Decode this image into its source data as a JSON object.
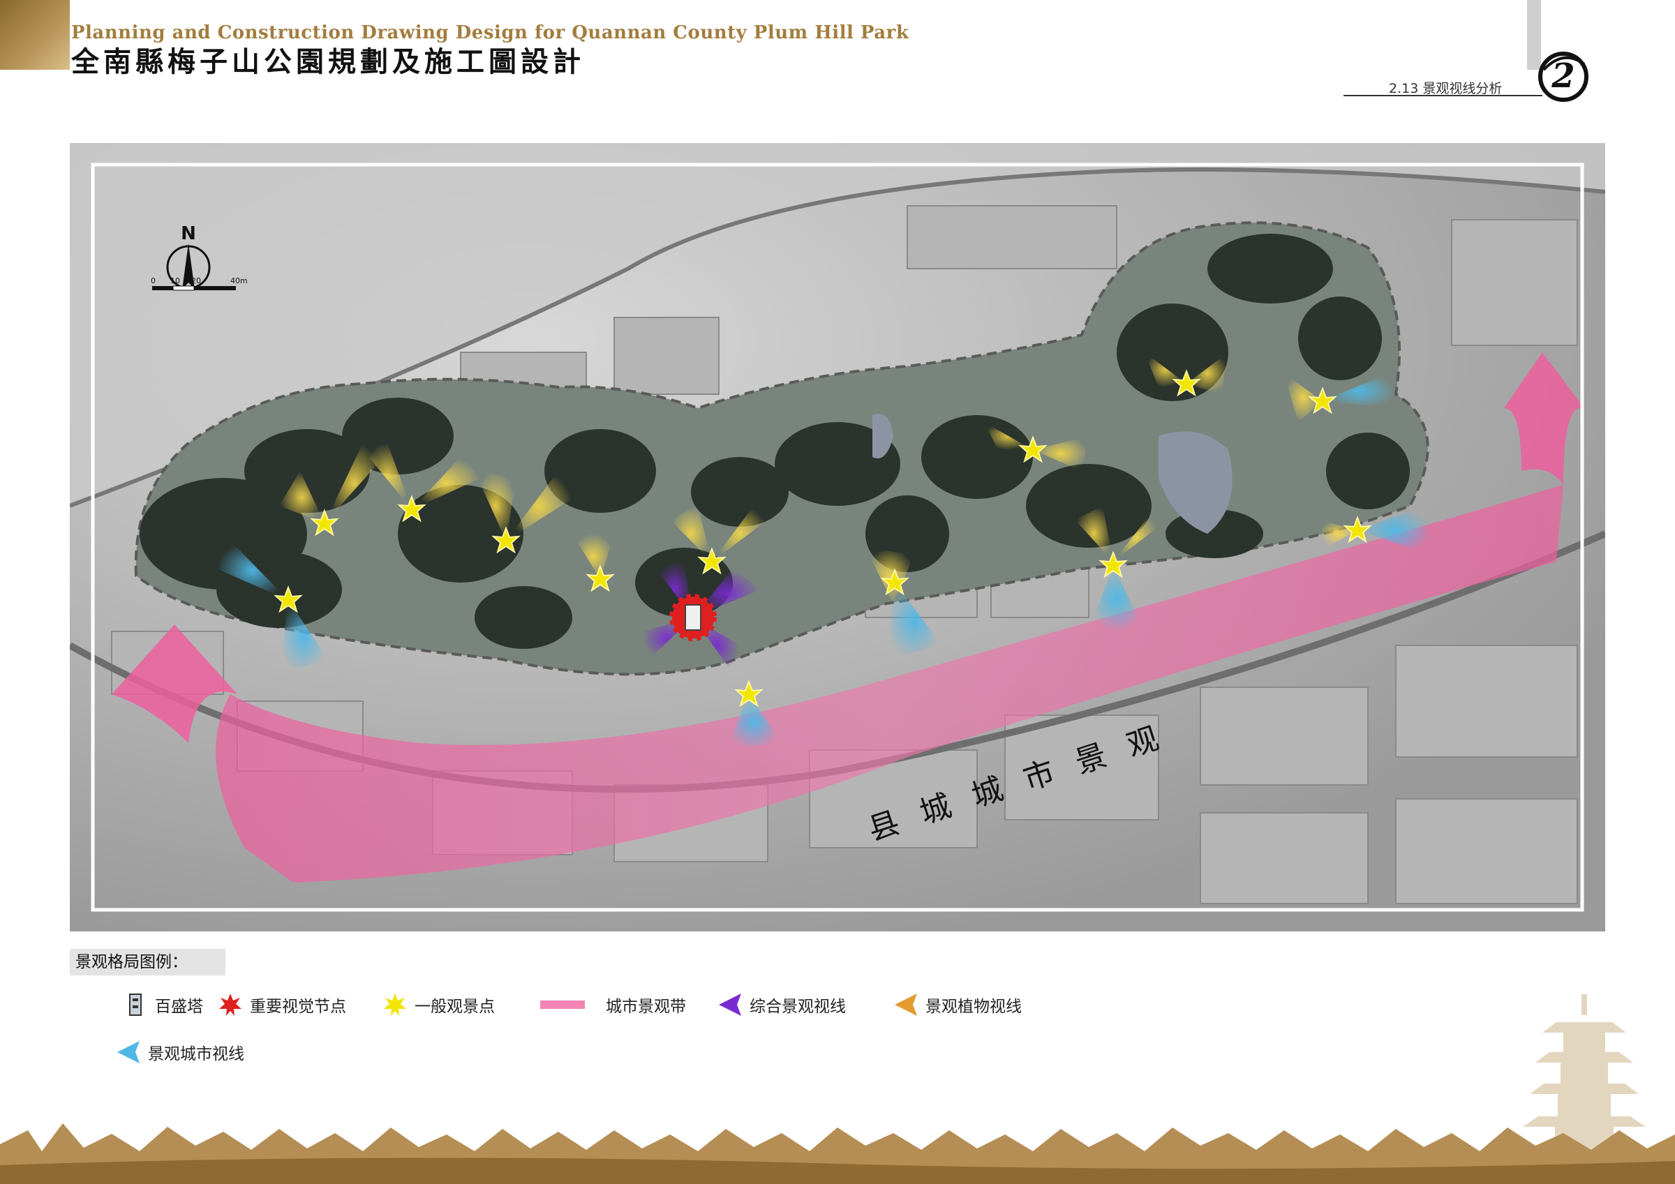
{
  "header": {
    "title_en": "Planning and Construction Drawing Design for Quannan County Plum Hill Park",
    "title_cn": "全南縣梅子山公園規劃及施工圖設計",
    "section_label": "2.13 景观视线分析",
    "page_number": "2"
  },
  "map": {
    "north_label": "N",
    "scale_labels": [
      "0",
      "10",
      "20",
      "40m"
    ],
    "city_band_label": "县城城市景观"
  },
  "legend": {
    "title": "景观格局图例：",
    "items": [
      {
        "label": "百盛塔",
        "icon": "pagoda-icon"
      },
      {
        "label": "重要视觉节点",
        "icon": "red-star-icon",
        "color": "#e02020"
      },
      {
        "label": "一般观景点",
        "icon": "yellow-star-icon",
        "color": "#f2e500"
      },
      {
        "label": "城市景观带",
        "icon": "pink-band-icon",
        "color": "#ee6fa6"
      },
      {
        "label": "综合景观视线",
        "icon": "purple-cone-icon",
        "color": "#7a2bd0"
      },
      {
        "label": "景观植物视线",
        "icon": "orange-cone-icon",
        "color": "#e39a2f"
      },
      {
        "label": "景观城市视线",
        "icon": "blue-cone-icon",
        "color": "#4fb7e6"
      }
    ]
  },
  "colors": {
    "accent_gold": "#a27d3e",
    "pink": "#ee6fa6",
    "yellow": "#f2e500",
    "blue": "#4fb7e6",
    "purple": "#7a2bd0",
    "red": "#e02020"
  }
}
